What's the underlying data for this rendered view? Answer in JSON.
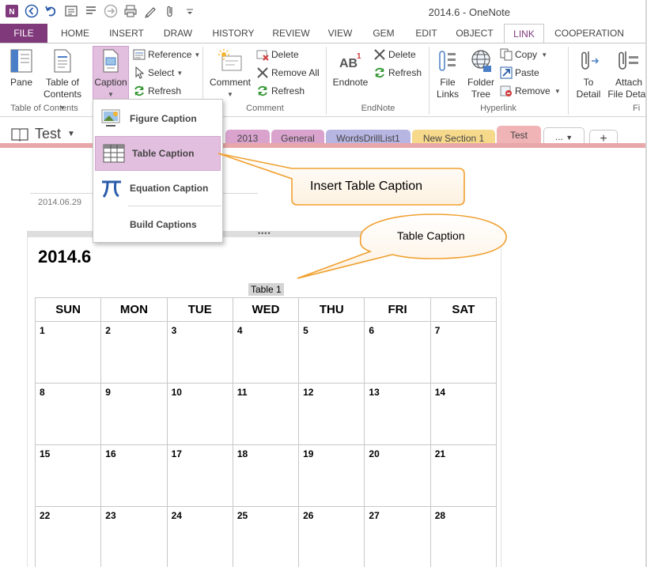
{
  "window": {
    "title": "2014.6 - OneNote"
  },
  "ribbon_tabs": [
    "FILE",
    "HOME",
    "INSERT",
    "DRAW",
    "HISTORY",
    "REVIEW",
    "VIEW",
    "GEM",
    "EDIT",
    "OBJECT",
    "LINK",
    "COOPERATION"
  ],
  "ribbon": {
    "pane_label": "Pane",
    "toc_label_1": "Table of",
    "toc_label_2": "Contents",
    "caption_label": "Caption",
    "reference_label": "Reference",
    "select_label": "Select",
    "refresh_label": "Refresh",
    "group_toc": "Table of Contents",
    "comment_label": "Comment",
    "delete_label": "Delete",
    "remove_all_label": "Remove All",
    "comment_refresh_label": "Refresh",
    "group_comment": "Comment",
    "endnote_label": "Endnote",
    "endnote_delete_label": "Delete",
    "endnote_refresh_label": "Refresh",
    "group_endnote": "EndNote",
    "file_links_1": "File",
    "file_links_2": "Links",
    "folder_tree_1": "Folder",
    "folder_tree_2": "Tree",
    "copy_label": "Copy",
    "paste_label": "Paste",
    "remove_label": "Remove",
    "group_hyperlink": "Hyperlink",
    "to_detail_1": "To",
    "to_detail_2": "Detail",
    "attach_1": "Attach",
    "attach_2": "File Detail",
    "group_truncated": "Fi"
  },
  "notebook": {
    "name": "Test",
    "sections": [
      {
        "label": "2013",
        "color": "#d9a3ce"
      },
      {
        "label": "General",
        "color": "#d9a3ce"
      },
      {
        "label": "WordsDrillList1",
        "color": "#b7b5e2"
      },
      {
        "label": "New Section 1",
        "color": "#f6d98b"
      },
      {
        "label": "Test",
        "color": "#f0b4b6"
      }
    ],
    "more_label": "...",
    "add_label": "+"
  },
  "dropdown": {
    "items": [
      {
        "label": "Figure Caption",
        "icon": "figure-caption-icon"
      },
      {
        "label": "Table Caption",
        "icon": "table-caption-icon"
      },
      {
        "label": "Equation Caption",
        "icon": "pi-icon"
      },
      {
        "label": "Build Captions",
        "icon": ""
      }
    ]
  },
  "page": {
    "date": "2014.06.29",
    "title": "2014.6",
    "table_caption": "Table 1"
  },
  "calendar": {
    "headers": [
      "SUN",
      "MON",
      "TUE",
      "WED",
      "THU",
      "FRI",
      "SAT"
    ],
    "rows": [
      [
        "1",
        "2",
        "3",
        "4",
        "5",
        "6",
        "7"
      ],
      [
        "8",
        "9",
        "10",
        "11",
        "12",
        "13",
        "14"
      ],
      [
        "15",
        "16",
        "17",
        "18",
        "19",
        "20",
        "21"
      ],
      [
        "22",
        "23",
        "24",
        "25",
        "26",
        "27",
        "28"
      ]
    ]
  },
  "callouts": {
    "insert_table_caption": "Insert Table Caption",
    "table_caption": "Table Caption"
  },
  "colors": {
    "accent": "#80397b",
    "selection": "#e2bfdf",
    "callout_border": "#f0a030"
  }
}
